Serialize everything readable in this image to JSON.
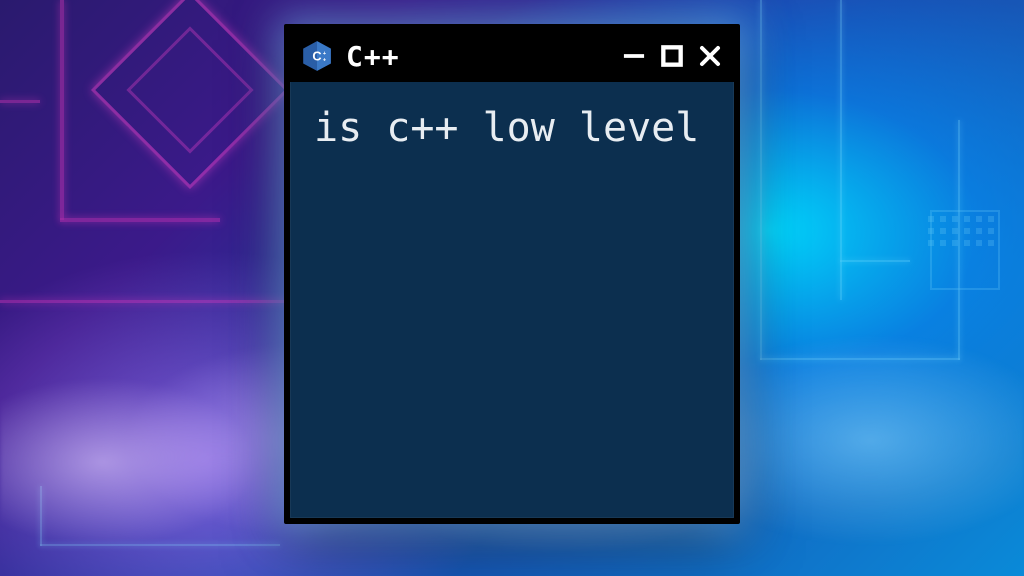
{
  "window": {
    "title": "C++",
    "icon_name": "cpp-logo-icon",
    "content_text": "is c++ low level",
    "colors": {
      "titlebar_bg": "#000000",
      "content_bg": "#0c2f4f",
      "text": "#e8edf2"
    }
  }
}
